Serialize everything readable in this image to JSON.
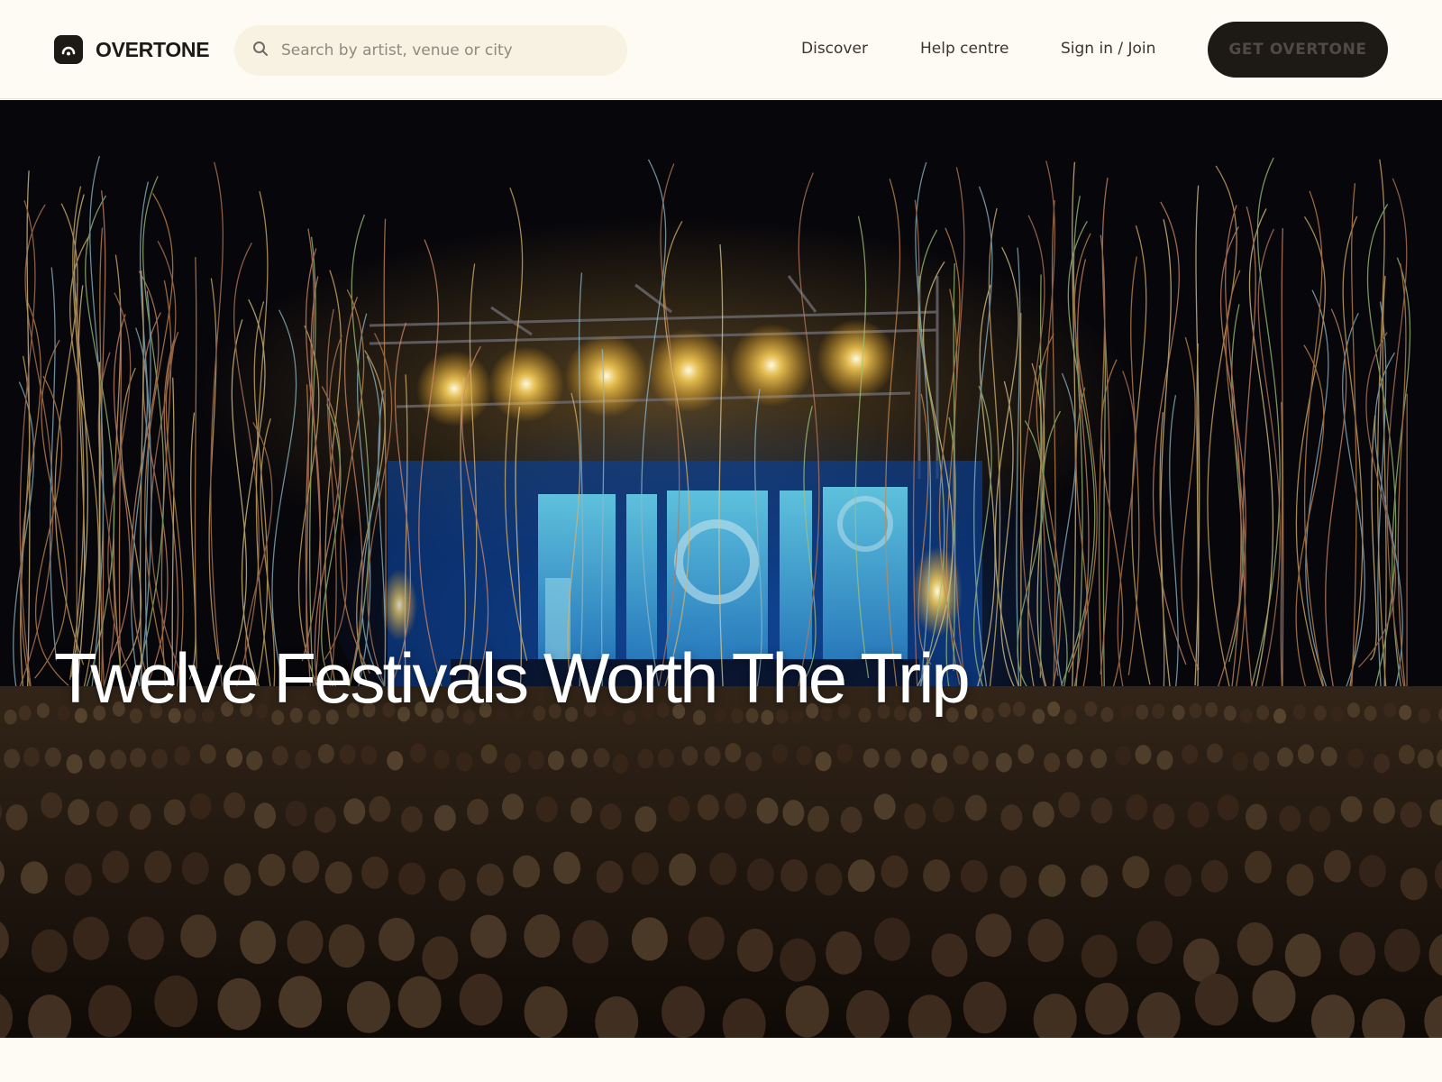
{
  "header": {
    "brand": "OVERTONE",
    "search_placeholder": "Search by artist, venue or city",
    "nav": {
      "discover": "Discover",
      "help": "Help centre",
      "sign_in": "Sign in / Join"
    },
    "cta_label": "GET OVERTONE"
  },
  "hero": {
    "title": "Twelve Festivals Worth The Trip"
  },
  "colors": {
    "background": "#fdfbf4",
    "dark": "#1d1a15",
    "search_bg": "#f8f2e2",
    "stage_blue": "#3fa0d8",
    "stage_light": "#ffd45a"
  },
  "icons": {
    "logo": "headphone-arc-logo",
    "search": "search-icon"
  }
}
